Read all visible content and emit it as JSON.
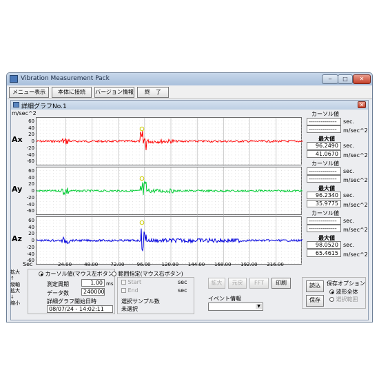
{
  "window": {
    "title": "Vibration Measurement Pack",
    "controls": {
      "minimize": "‒",
      "maximize": "□",
      "close": "✕"
    }
  },
  "menubar": [
    {
      "label": "メニュー表示"
    },
    {
      "label": "本体に接続"
    },
    {
      "label": "バージョン情報"
    },
    {
      "label": "終　了"
    }
  ],
  "subwindow": {
    "title": "詳細グラフNo.1",
    "close": "✕"
  },
  "graph": {
    "unit_top": "m/sec^2",
    "x_unit": "Sec",
    "y_ticks": [
      "60",
      "40",
      "20",
      "0",
      "-20",
      "-40",
      "-60"
    ],
    "x_ticks": [
      "24.00",
      "48.00",
      "72.00",
      "96.00",
      "120.00",
      "144.00",
      "168.00",
      "192.00",
      "216.00"
    ],
    "colors": {
      "ax": "#ff0000",
      "ay": "#00cc33",
      "az": "#0000dd",
      "cursor_marker": "#cccc00"
    }
  },
  "channels": [
    {
      "name": "Ax",
      "cursor_label": "カーソル値",
      "cursor_sec": "--------------",
      "cursor_val": "--------------",
      "sec_unit": "sec.",
      "val_unit": "m/sec^2",
      "max_label": "最大値",
      "max_sec": "96.2490",
      "max_val": "41.0670"
    },
    {
      "name": "Ay",
      "cursor_label": "カーソル値",
      "cursor_sec": "--------------",
      "cursor_val": "--------------",
      "sec_unit": "sec.",
      "val_unit": "m/sec^2",
      "max_label": "最大値",
      "max_sec": "96.2340",
      "max_val": "35.9775"
    },
    {
      "name": "Az",
      "cursor_label": "カーソル値",
      "cursor_sec": "--------------",
      "cursor_val": "--------------",
      "sec_unit": "sec.",
      "val_unit": "m/sec^2",
      "max_label": "最大値",
      "max_sec": "98.0520",
      "max_val": "65.4615"
    }
  ],
  "zoom_sidebar": "拡大\n↑\n縦軸\n拡大\n↓\n縮小",
  "cursor_mode": {
    "cursor_value": "カーソル値(マウス左ボタン)",
    "range": "範囲指定(マウス右ボタン)",
    "selected": "cursor_value"
  },
  "info": {
    "period_label": "測定周期",
    "period_value": "1.00",
    "period_unit": "ms",
    "count_label": "データ数",
    "count_value": "240000",
    "start_label": "詳細グラフ開始日時",
    "start_value": "08/07/24 - 14:02:11"
  },
  "range": {
    "start_label": "Start",
    "end_label": "End",
    "unit": "sec",
    "samples_label": "選択サンプル数",
    "samples_value": "未選択"
  },
  "tools": {
    "zoom": "拡大",
    "reset": "元戻",
    "fft": "FFT",
    "print": "印刷"
  },
  "event": {
    "label": "イベント情報",
    "selected": ""
  },
  "file": {
    "load": "読込",
    "save": "保存"
  },
  "save_option": {
    "title": "保存オプション",
    "all": "波形全体",
    "range": "選択範囲",
    "selected": "all"
  }
}
